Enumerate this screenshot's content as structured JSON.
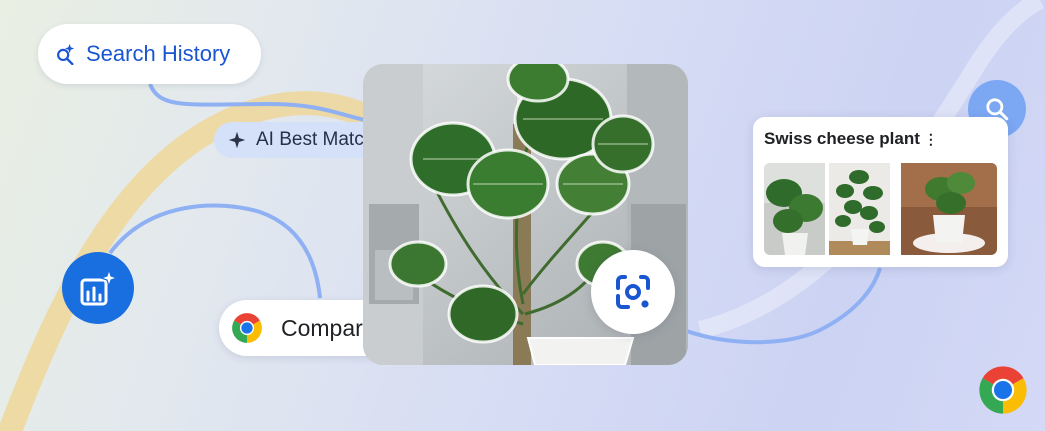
{
  "chips": {
    "search_history": "Search History",
    "ai_best_match": "AI Best Match",
    "compare": "Compare"
  },
  "result_card": {
    "title": "Swiss cheese plant",
    "menu_glyph": "⋮"
  },
  "icons": {
    "search_history": "sparkle-search-icon",
    "ai_best_match": "sparkle-icon",
    "compare": "chrome-logo-icon",
    "insights": "insights-sparkle-icon",
    "search": "search-icon",
    "lens": "google-lens-icon",
    "brand": "chrome-logo-icon"
  },
  "colors": {
    "chrome_red": "#ea4335",
    "chrome_yellow": "#fbbc04",
    "chrome_green": "#34a853",
    "chrome_blue": "#1a73e8",
    "link_blue": "#1a56d1",
    "connector_blue": "#8fb1f3",
    "accent_gold": "#f0d48c"
  }
}
